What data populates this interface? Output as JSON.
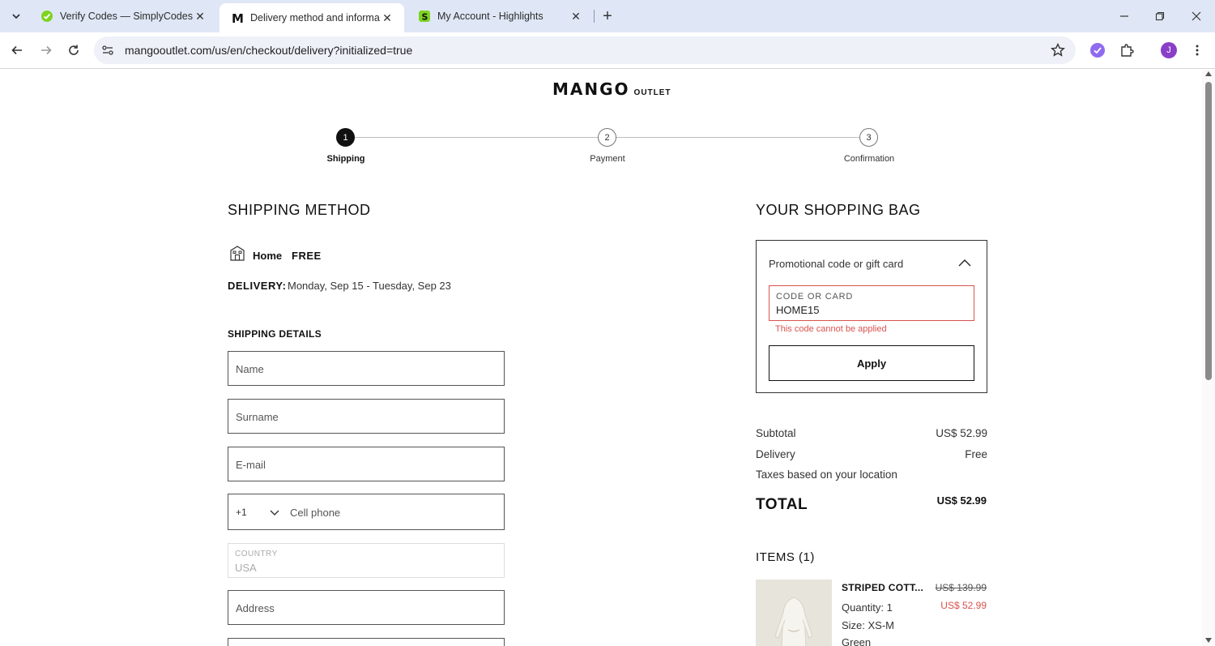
{
  "browser": {
    "tabs": [
      {
        "title": "Verify Codes — SimplyCodes",
        "favicon": "simplycodes-check-icon"
      },
      {
        "title": "Delivery method and informatio",
        "favicon": "mango-m-icon"
      },
      {
        "title": "My Account - Highlights",
        "favicon": "simplycodes-s-icon"
      }
    ],
    "url": "mangooutlet.com/us/en/checkout/delivery?initialized=true",
    "profile_initial": "J"
  },
  "brand": {
    "main": "MANGO",
    "sub": "OUTLET"
  },
  "steps": [
    {
      "number": "1",
      "label": "Shipping",
      "active": true
    },
    {
      "number": "2",
      "label": "Payment",
      "active": false
    },
    {
      "number": "3",
      "label": "Confirmation",
      "active": false
    }
  ],
  "shipping": {
    "heading": "SHIPPING METHOD",
    "method": "Home",
    "price": "FREE",
    "delivery_label": "DELIVERY:",
    "delivery_dates": "Monday, Sep 15 - Tuesday, Sep 23",
    "details_heading": "SHIPPING DETAILS",
    "fields": {
      "name": "Name",
      "surname": "Surname",
      "email": "E-mail",
      "phone_prefix": "+1",
      "phone": "Cell phone",
      "country_label": "COUNTRY",
      "country_value": "USA",
      "address": "Address"
    }
  },
  "bag": {
    "heading": "YOUR SHOPPING BAG",
    "promo_title": "Promotional code or gift card",
    "code_label": "CODE OR CARD",
    "code_value": "HOME15",
    "code_error": "This code cannot be applied",
    "apply_label": "Apply",
    "subtotal_label": "Subtotal",
    "subtotal_value": "US$ 52.99",
    "delivery_label": "Delivery",
    "delivery_value": "Free",
    "taxes_label": "Taxes based on your location",
    "total_label": "TOTAL",
    "total_value": "US$ 52.99",
    "items_heading": "ITEMS (1)",
    "item": {
      "name": "STRIPED COTT...",
      "old_price": "US$ 139.99",
      "new_price": "US$ 52.99",
      "quantity": "Quantity: 1",
      "size": "Size: XS-M",
      "color": "Green"
    }
  },
  "colors": {
    "error": "#d9534f",
    "chrome": "#dfe7f6",
    "active_step": "#111111"
  }
}
